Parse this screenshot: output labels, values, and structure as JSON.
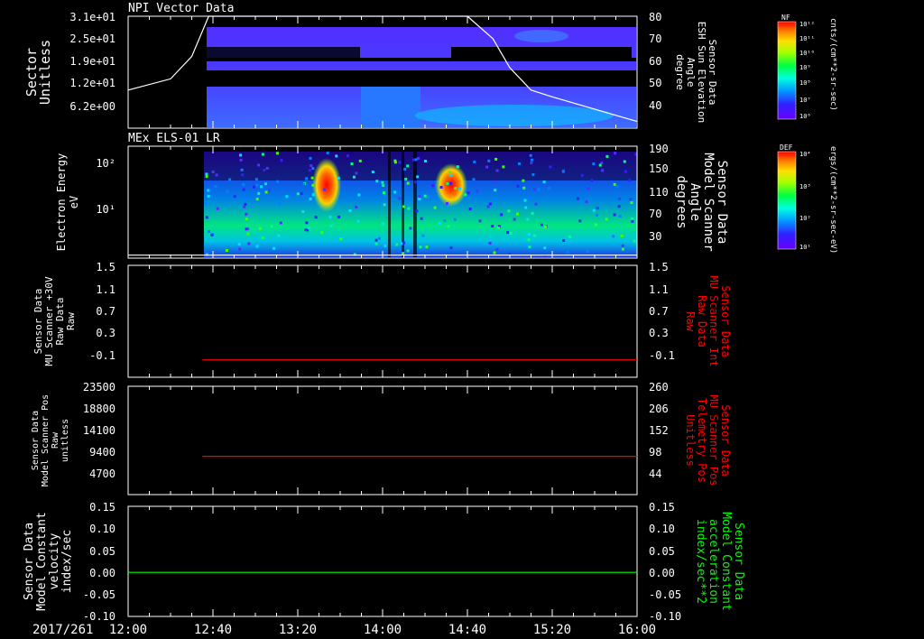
{
  "date_label": "2017/261",
  "x_ticks": [
    "12:00",
    "12:40",
    "13:20",
    "14:00",
    "14:40",
    "15:20",
    "16:00"
  ],
  "colors": {
    "background": "#000000",
    "axes": "#ffffff",
    "trace_red": "#ff0000",
    "trace_green": "#00ff00",
    "label_red": "#ff0000",
    "label_green": "#00ff00"
  },
  "chart_data": [
    {
      "type": "heatmap",
      "title": "NPI Vector Data",
      "ylabel": [
        "Sector",
        "Unitless"
      ],
      "y_ticks": [
        "3.1e+01",
        "2.5e+01",
        "1.9e+01",
        "1.2e+01",
        "6.2e+00"
      ],
      "ylabel_right": [
        "Sensor Data",
        "ESH Sun Elevation",
        "Angle",
        "degree"
      ],
      "y_ticks_right": [
        "80",
        "70",
        "60",
        "50",
        "40"
      ],
      "y_right_range": [
        30,
        80
      ],
      "overlay_line": {
        "x": [
          "12:00",
          "12:20",
          "12:30",
          "12:38",
          "12:50",
          "14:00",
          "14:40",
          "14:52",
          "15:00",
          "15:10",
          "15:20",
          "16:00"
        ],
        "y": [
          47,
          52,
          62,
          80,
          80,
          80,
          80,
          70,
          57,
          47,
          44,
          33
        ]
      },
      "colorbar": {
        "name": "NF",
        "units": "cnts/(cm**2-sr-sec)",
        "ticks": [
          "10¹²",
          "10¹¹",
          "10¹⁰",
          "10⁹",
          "10⁸",
          "10⁷",
          "10⁶"
        ]
      }
    },
    {
      "type": "heatmap",
      "title": "MEx ELS-01 LR",
      "ylabel": [
        "Electron Energy",
        "eV"
      ],
      "y_ticks": [
        "10²",
        "10¹"
      ],
      "ylabel_right": [
        "Sensor Data",
        "Model Scanner",
        "Angle",
        "degrees"
      ],
      "y_ticks_right": [
        "190",
        "150",
        "110",
        "70",
        "30"
      ],
      "y_right_range": [
        0,
        190
      ],
      "overlay_line": {
        "x": [
          "12:00",
          "16:00"
        ],
        "y": [
          5,
          5
        ]
      },
      "colorbar": {
        "name": "DEF",
        "units": "ergs/(cm**2-sr-sec-eV)",
        "ticks": [
          "10⁴",
          "10³",
          "10²",
          "10¹"
        ]
      }
    },
    {
      "type": "line",
      "ylabel": [
        "Sensor Data",
        "MU Scanner +30V",
        "Raw Data",
        "Raw"
      ],
      "y_ticks": [
        "1.5",
        "1.1",
        "0.7",
        "0.3",
        "-0.1"
      ],
      "ylim": [
        -0.3,
        1.5
      ],
      "ylabel_right": [
        "Sensor Data",
        "MU Scanner Int",
        "Raw Data",
        "Raw"
      ],
      "y_ticks_right": [
        "1.5",
        "1.1",
        "0.7",
        "0.3",
        "-0.1"
      ],
      "series": [
        {
          "x": [
            "12:35",
            "16:00"
          ],
          "y": [
            -0.02,
            -0.02
          ],
          "color": "#ff0000"
        }
      ]
    },
    {
      "type": "line",
      "ylabel": [
        "Sensor Data",
        "Model Scanner Pos",
        "Raw",
        "unitless"
      ],
      "y_ticks": [
        "23500",
        "18800",
        "14100",
        "9400",
        "4700"
      ],
      "ylim": [
        0,
        23500
      ],
      "ylabel_right": [
        "Sensor Data",
        "MU Scanner Pos",
        "Telemetry Pos",
        "Unitless"
      ],
      "y_ticks_right": [
        "260",
        "206",
        "152",
        "98",
        "44"
      ],
      "series": [
        {
          "x": [
            "12:35",
            "16:00"
          ],
          "y": [
            8300,
            8300
          ],
          "color": "#ff0000"
        }
      ]
    },
    {
      "type": "line",
      "ylabel": [
        "Sensor Data",
        "Model Constant",
        "velocity",
        "index/sec"
      ],
      "y_ticks": [
        "0.15",
        "0.10",
        "0.05",
        "0.00",
        "-0.05",
        "-0.10"
      ],
      "ylim": [
        -0.1,
        0.15
      ],
      "ylabel_right": [
        "Sensor Data",
        "Model Constant",
        "acceleration",
        "index/sec**2"
      ],
      "y_ticks_right": [
        "0.15",
        "0.10",
        "0.05",
        "0.00",
        "-0.05",
        "-0.10"
      ],
      "series": [
        {
          "x": [
            "12:00",
            "16:00"
          ],
          "y": [
            0.0,
            0.0
          ],
          "color": "#00ff00"
        }
      ]
    }
  ]
}
